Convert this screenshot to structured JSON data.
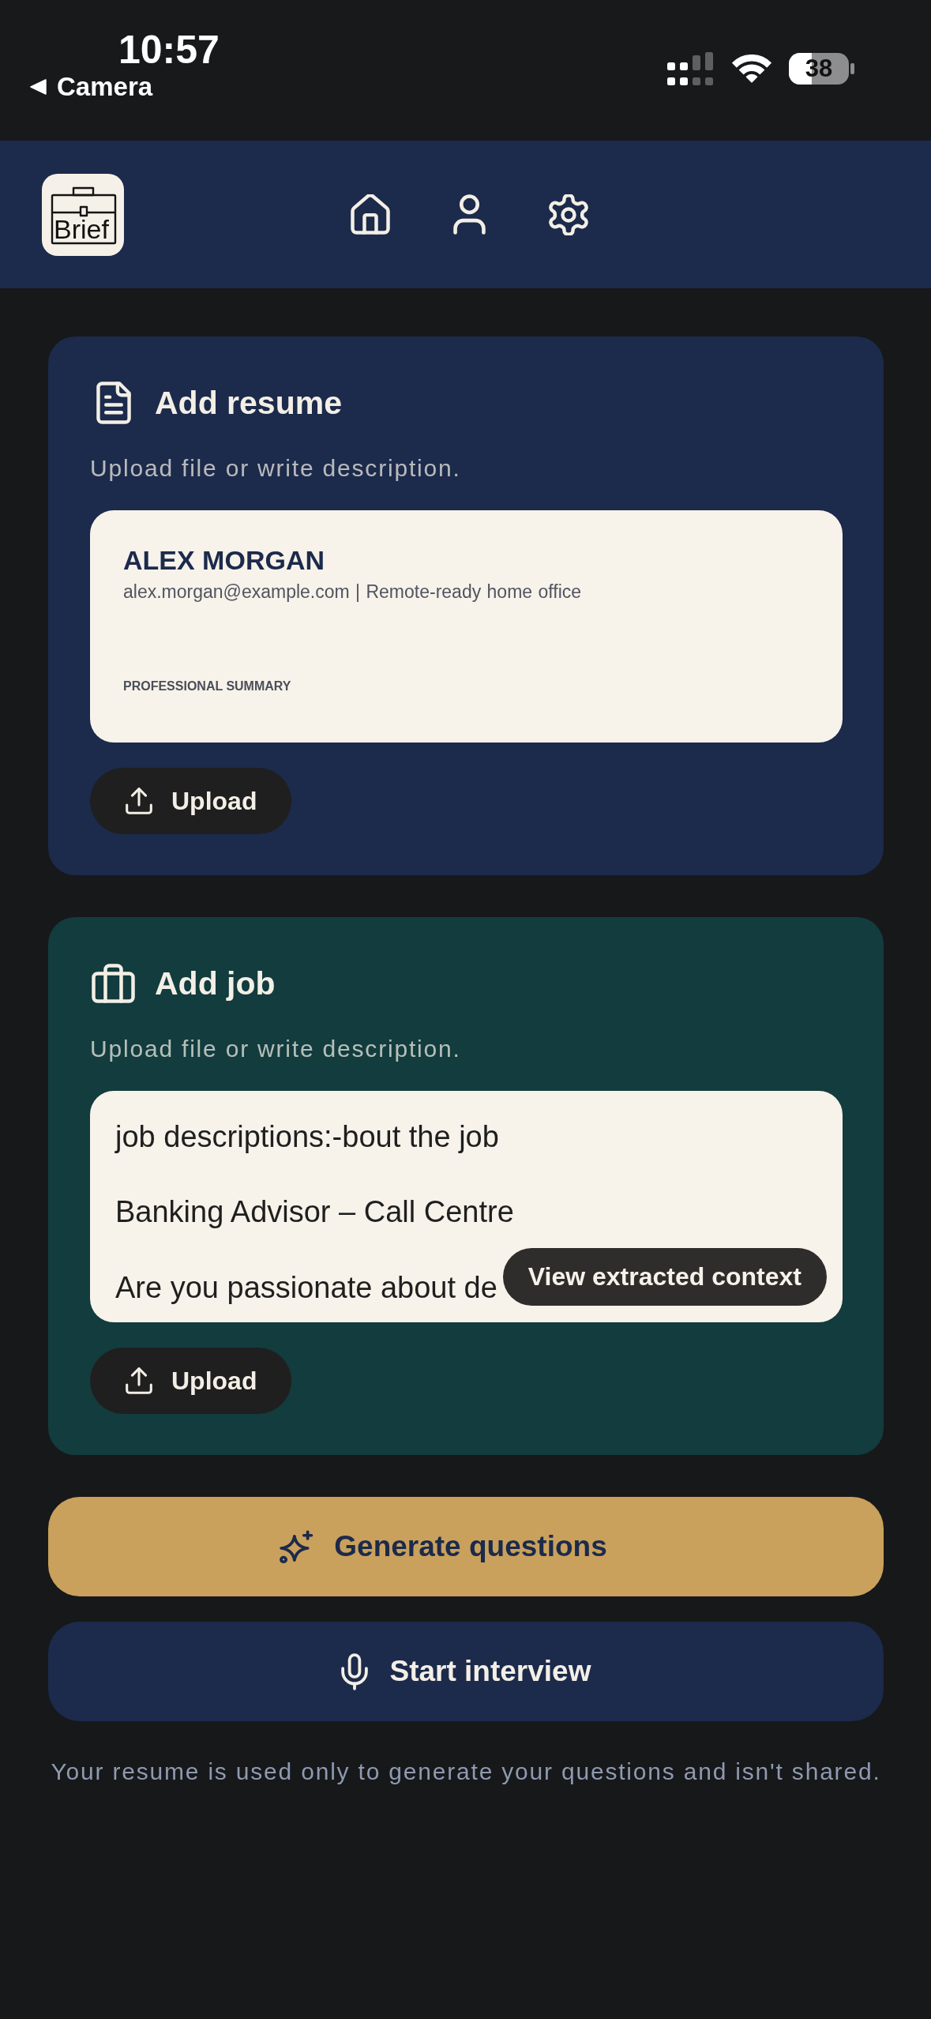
{
  "status_bar": {
    "time": "10:57",
    "back_label": "Camera",
    "battery": "38"
  },
  "header": {
    "logo_text": "Brief",
    "nav": [
      {
        "kind": "home"
      },
      {
        "kind": "profile"
      },
      {
        "kind": "settings"
      }
    ]
  },
  "cards": [
    {
      "kind": "resume",
      "title": "Add resume",
      "subtitle": "Upload file or write description.",
      "preview": {
        "name": "ALEX MORGAN",
        "contact": "alex.morgan@example.com | Remote-ready home office",
        "section_heading": "PROFESSIONAL SUMMARY"
      },
      "upload_label": "Upload"
    },
    {
      "kind": "job",
      "title": "Add job",
      "subtitle": "Upload file or write description.",
      "field_paragraphs": [
        "job descriptions:-bout the job",
        "Banking Advisor – Call Centre",
        "Are you passionate about de"
      ],
      "overlay_button": "View extracted context",
      "upload_label": "Upload"
    }
  ],
  "actions": [
    {
      "kind": "generate",
      "label": "Generate questions"
    },
    {
      "kind": "interview",
      "label": "Start interview"
    }
  ],
  "footer_note": "Your resume is used only to generate your questions and isn't shared."
}
